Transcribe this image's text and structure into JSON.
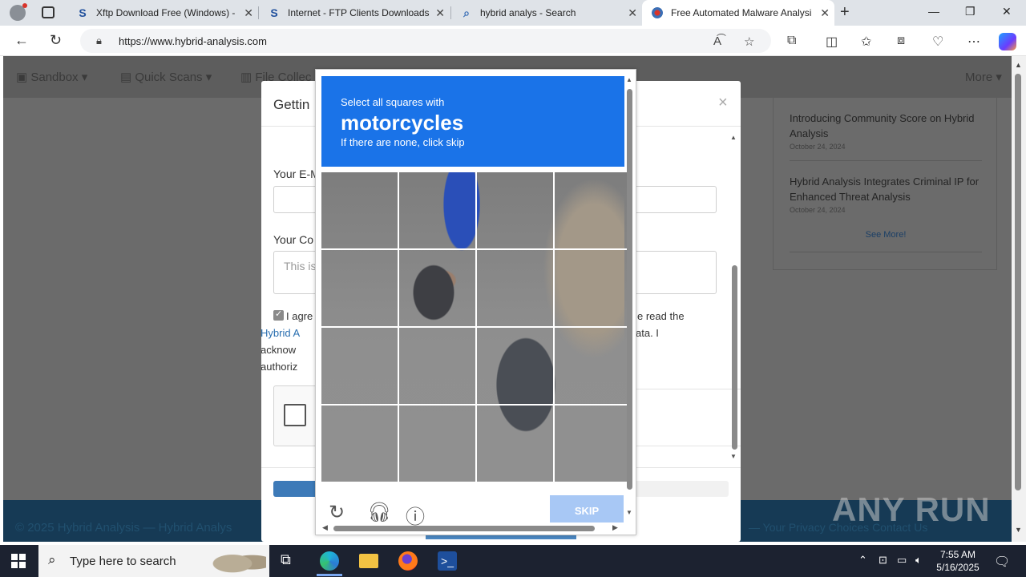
{
  "browser": {
    "tabs": [
      {
        "label": "Xftp Download Free (Windows) -",
        "icon": "softpedia-s-icon"
      },
      {
        "label": "Internet - FTP Clients Downloads",
        "icon": "softpedia-s-icon"
      },
      {
        "label": "hybrid analys - Search",
        "icon": "search-icon"
      },
      {
        "label": "Free Automated Malware Analysi",
        "icon": "hybrid-analysis-icon",
        "active": true
      }
    ],
    "url_host": "https://www.hybrid-analysis.com"
  },
  "site": {
    "nav": [
      "Sandbox",
      "Quick Scans",
      "File Collec",
      "More"
    ],
    "news": [
      {
        "title": "Introducing Community Score on Hybrid Analysis",
        "date": "October 24, 2024"
      },
      {
        "title": "Hybrid Analysis Integrates Criminal IP for Enhanced Threat Analysis",
        "date": "October 24, 2024"
      }
    ],
    "see_more": "See More!",
    "footer_copy": "© 2025 Hybrid Analysis — Hybrid Analys",
    "footer_links": "— Your Privacy Choices   Contact Us"
  },
  "modal": {
    "title": "Gettin",
    "email_label": "Your E-M",
    "comment_label": "Your Co",
    "comment_placeholder": "This is",
    "agree_text_1": "I agre",
    "agree_text_2": "e read the",
    "agree_link": "Hybrid A",
    "agree_text_3": "ata. I",
    "agree_text_4": "acknow",
    "agree_text_5": "authoriz",
    "progress_fraction": 0.12
  },
  "challenge": {
    "line1": "Select all squares with",
    "line2": "motorcycles",
    "line3": "If there are none, click skip",
    "skip_label": "SKIP",
    "grid_rows": 4,
    "grid_cols": 4
  },
  "watermark": "ANY RUN",
  "taskbar": {
    "search_placeholder": "Type here to search",
    "time": "7:55 AM",
    "date": "5/16/2025"
  }
}
